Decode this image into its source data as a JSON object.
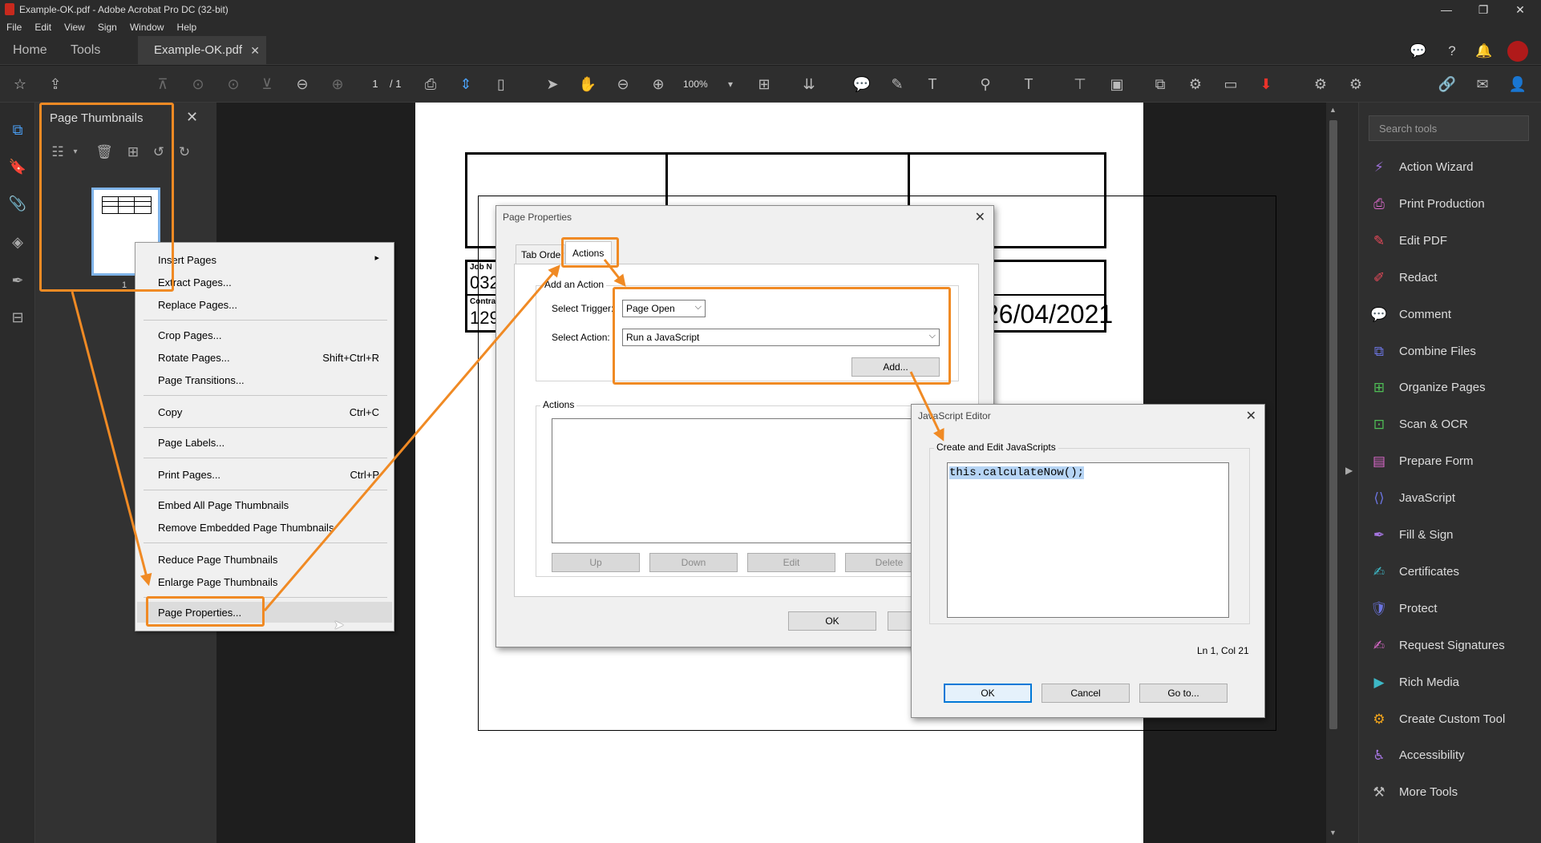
{
  "window": {
    "title": "Example-OK.pdf - Adobe Acrobat Pro DC (32-bit)",
    "controls": [
      "—",
      "❐",
      "✕"
    ]
  },
  "menubar": [
    "File",
    "Edit",
    "View",
    "Sign",
    "Window",
    "Help"
  ],
  "tabs": {
    "home": "Home",
    "tools": "Tools",
    "document": "Example-OK.pdf",
    "close": "✕"
  },
  "toolbar": {
    "page_current": "1",
    "page_total": "/ 1",
    "zoom": "100%"
  },
  "thumbnails_panel": {
    "title": "Page Thumbnails",
    "close": "✕",
    "thumb_page_number": "1"
  },
  "context_menu": {
    "items": [
      {
        "label": "Insert Pages",
        "shortcut": "▸"
      },
      {
        "label": "Extract Pages...",
        "shortcut": ""
      },
      {
        "label": "Replace Pages...",
        "shortcut": ""
      },
      {
        "label": "Crop Pages...",
        "shortcut": ""
      },
      {
        "label": "Rotate Pages...",
        "shortcut": "Shift+Ctrl+R"
      },
      {
        "label": "Page Transitions...",
        "shortcut": ""
      },
      {
        "label": "Copy",
        "shortcut": "Ctrl+C"
      },
      {
        "label": "Page Labels...",
        "shortcut": ""
      },
      {
        "label": "Print Pages...",
        "shortcut": "Ctrl+P"
      },
      {
        "label": "Embed All Page Thumbnails",
        "shortcut": ""
      },
      {
        "label": "Remove Embedded Page Thumbnails",
        "shortcut": ""
      },
      {
        "label": "Reduce Page Thumbnails",
        "shortcut": ""
      },
      {
        "label": "Enlarge Page Thumbnails",
        "shortcut": ""
      },
      {
        "label": "Page Properties...",
        "shortcut": ""
      }
    ]
  },
  "pdf_page": {
    "job_label": "Job N",
    "job_value": "032",
    "contract_label": "Contra",
    "contract_value": "129",
    "date_value": "26/04/2021"
  },
  "page_properties_dialog": {
    "title": "Page Properties",
    "close": "✕",
    "tabs": [
      "Tab Order",
      "Actions"
    ],
    "add_action_group": "Add an Action",
    "trigger_label": "Select Trigger:",
    "trigger_value": "Page Open",
    "action_label": "Select Action:",
    "action_value": "Run a JavaScript",
    "add_button": "Add...",
    "actions_group": "Actions",
    "buttons": {
      "up": "Up",
      "down": "Down",
      "edit": "Edit",
      "delete": "Delete",
      "ok": "OK"
    }
  },
  "js_editor_dialog": {
    "title": "JavaScript Editor",
    "close": "✕",
    "group": "Create and Edit JavaScripts",
    "code": "this.calculateNow();",
    "cursor_pos": "Ln 1, Col 21",
    "buttons": {
      "ok": "OK",
      "cancel": "Cancel",
      "goto": "Go to..."
    }
  },
  "right_panel": {
    "search_placeholder": "Search tools",
    "tools": [
      {
        "label": "Action Wizard",
        "icon": "action-wizard-icon",
        "color": "#9b6fd6"
      },
      {
        "label": "Print Production",
        "icon": "print-production-icon",
        "color": "#d868c8"
      },
      {
        "label": "Edit PDF",
        "icon": "edit-pdf-icon",
        "color": "#e8495a"
      },
      {
        "label": "Redact",
        "icon": "redact-icon",
        "color": "#e8495a"
      },
      {
        "label": "Comment",
        "icon": "comment-icon",
        "color": "#f2c01c"
      },
      {
        "label": "Combine Files",
        "icon": "combine-files-icon",
        "color": "#6b74e0"
      },
      {
        "label": "Organize Pages",
        "icon": "organize-pages-icon",
        "color": "#4fbf56"
      },
      {
        "label": "Scan & OCR",
        "icon": "scan-ocr-icon",
        "color": "#4fbf56"
      },
      {
        "label": "Prepare Form",
        "icon": "prepare-form-icon",
        "color": "#d868c8"
      },
      {
        "label": "JavaScript",
        "icon": "javascript-icon",
        "color": "#6b74e0"
      },
      {
        "label": "Fill & Sign",
        "icon": "fill-sign-icon",
        "color": "#a575e0"
      },
      {
        "label": "Certificates",
        "icon": "certificates-icon",
        "color": "#3db8c6"
      },
      {
        "label": "Protect",
        "icon": "protect-icon",
        "color": "#6b74e0"
      },
      {
        "label": "Request Signatures",
        "icon": "request-signatures-icon",
        "color": "#d868c8"
      },
      {
        "label": "Rich Media",
        "icon": "rich-media-icon",
        "color": "#3db8c6"
      },
      {
        "label": "Create Custom Tool",
        "icon": "custom-tool-icon",
        "color": "#f2a51c"
      },
      {
        "label": "Accessibility",
        "icon": "accessibility-icon",
        "color": "#a575e0"
      },
      {
        "label": "More Tools",
        "icon": "more-tools-icon",
        "color": "#bbbbbb"
      }
    ]
  },
  "colors": {
    "annotation": "#f08a24",
    "accent_blue": "#4a9ff5"
  }
}
